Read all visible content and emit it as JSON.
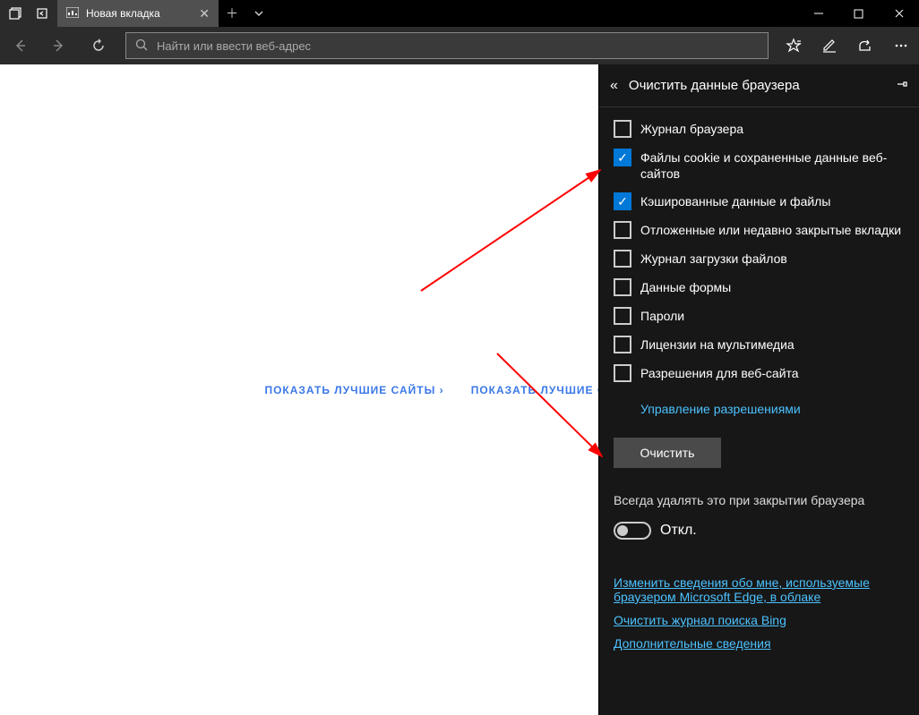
{
  "tab": {
    "title": "Новая вкладка"
  },
  "addressbar": {
    "placeholder": "Найти или ввести веб-адрес"
  },
  "content": {
    "link1": "ПОКАЗАТЬ ЛУЧШИЕ САЙТЫ ›",
    "link2": "ПОКАЗАТЬ ЛУЧШИЕ САЙТЫ И"
  },
  "panel": {
    "title": "Очистить данные браузера",
    "items": [
      {
        "label": "Журнал браузера",
        "checked": false
      },
      {
        "label": "Файлы cookie и сохраненные данные веб-сайтов",
        "checked": true
      },
      {
        "label": "Кэшированные данные и файлы",
        "checked": true
      },
      {
        "label": "Отложенные или недавно закрытые вкладки",
        "checked": false
      },
      {
        "label": "Журнал загрузки файлов",
        "checked": false
      },
      {
        "label": "Данные формы",
        "checked": false
      },
      {
        "label": "Пароли",
        "checked": false
      },
      {
        "label": "Лицензии на мультимедиа",
        "checked": false
      },
      {
        "label": "Разрешения для веб-сайта",
        "checked": false
      }
    ],
    "manage_permissions": "Управление разрешениями",
    "clear_button": "Очистить",
    "always_clear_label": "Всегда удалять это при закрытии браузера",
    "toggle_state": "Откл.",
    "links": {
      "change_info": "Изменить сведения обо мне, используемые браузером Microsoft Edge, в облаке",
      "clear_bing": "Очистить журнал поиска Bing",
      "more_info": "Дополнительные сведения"
    }
  }
}
